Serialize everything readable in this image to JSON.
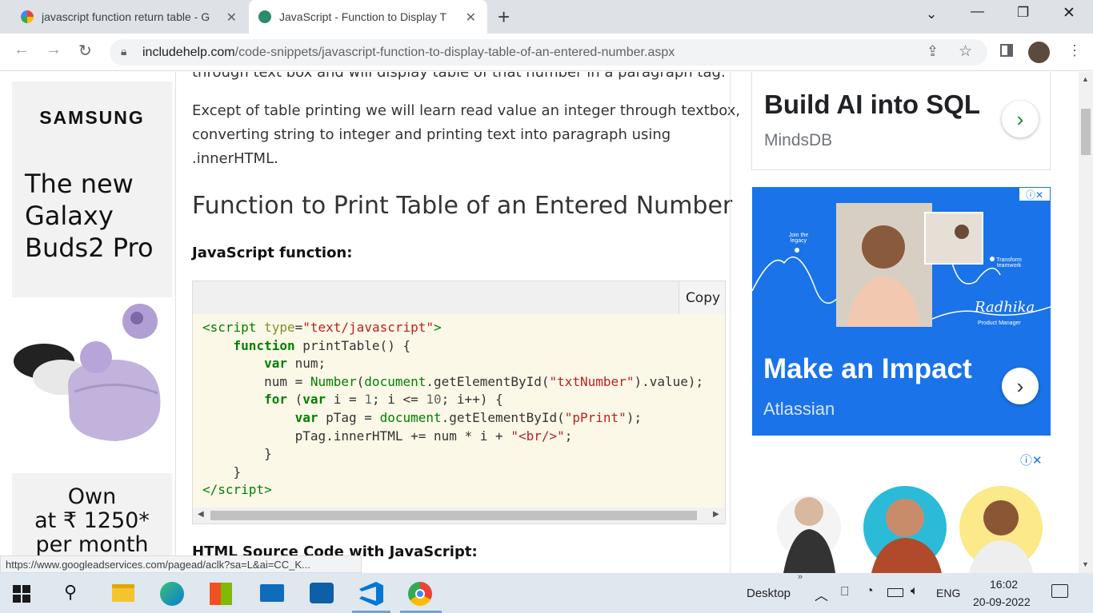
{
  "browser": {
    "tabs": [
      {
        "title": "javascript function return table - G",
        "active": false
      },
      {
        "title": "JavaScript - Function to Display T",
        "active": true
      }
    ],
    "url_domain": "includehelp.com",
    "url_path": "/code-snippets/javascript-function-to-display-table-of-an-entered-number.aspx",
    "status_url": "https://www.googleadservices.com/pagead/aclk?sa=L&ai=CC_K..."
  },
  "article": {
    "partial_line": "through text box and will display table of that number in a paragraph tag.",
    "paragraph": [
      "Except of table printing we will learn read value an integer through textbox,",
      "converting string to integer and printing text into paragraph using",
      ".innerHTML."
    ],
    "heading": "Function to Print Table of an Entered Number",
    "subheading": "JavaScript function:",
    "copy_label": "Copy",
    "next_heading": "HTML Source Code with JavaScript:"
  },
  "left_ad": {
    "brand": "SAMSUNG",
    "headline": [
      "The new",
      "Galaxy",
      "Buds2 Pro"
    ],
    "offer": [
      "Own",
      "at ₹ 1250*",
      "per month"
    ]
  },
  "right_ads": {
    "ad1": {
      "title": "Build AI into SQL",
      "advertiser": "MindsDB"
    },
    "ad2": {
      "title": "Make an Impact",
      "advertiser": "Atlassian",
      "tag1": "Join the legacy",
      "tag2": "Transform teamwork",
      "signature": "Radhika",
      "role": "Product Manager"
    }
  },
  "taskbar": {
    "desktop_label": "Desktop",
    "language": "ENG",
    "time": "16:02",
    "date": "20-09-2022"
  },
  "colors": {
    "accent": "#1a73e8",
    "code_bg": "#fcf8e8",
    "taskbar": "#dfe7ef"
  }
}
